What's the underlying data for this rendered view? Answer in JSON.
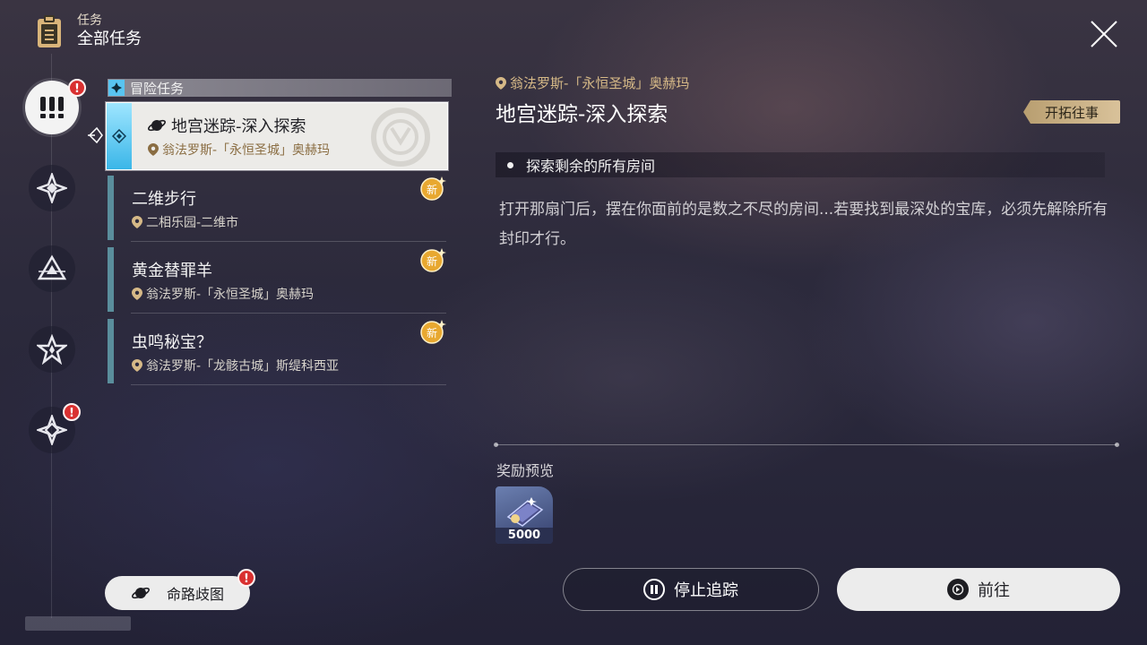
{
  "header": {
    "category_small": "任务",
    "category_main": "全部任务"
  },
  "nav": {
    "items": [
      {
        "name": "adventure",
        "active": true,
        "badge": "!"
      },
      {
        "name": "star-diamond",
        "active": false,
        "badge": ""
      },
      {
        "name": "triangle",
        "active": false,
        "badge": ""
      },
      {
        "name": "star",
        "active": false,
        "badge": ""
      },
      {
        "name": "diamond",
        "active": false,
        "badge": "!"
      }
    ]
  },
  "quest_list": {
    "category_label": "冒险任务",
    "quests": [
      {
        "title": "地宫迷踪-深入探索",
        "location": "翁法罗斯-「永恒圣城」奥赫玛",
        "selected": true,
        "new": false
      },
      {
        "title": "二维步行",
        "location": "二相乐园-二维市",
        "selected": false,
        "new": true
      },
      {
        "title": "黄金替罪羊",
        "location": "翁法罗斯-「永恒圣城」奥赫玛",
        "selected": false,
        "new": true
      },
      {
        "title": "虫鸣秘宝？",
        "location": "翁法罗斯-「龙骸古城」斯缇科西亚",
        "selected": false,
        "new": true
      }
    ],
    "new_label": "新"
  },
  "detail": {
    "location": "翁法罗斯-「永恒圣城」奥赫玛",
    "title": "地宫迷踪-深入探索",
    "trailblaze_button": "开拓往事",
    "objective": "探索剩余的所有房间",
    "description": "打开那扇门后，摆在你面前的是数之不尽的房间...若要找到最深处的宝库，必须先解除所有封印才行。"
  },
  "rewards": {
    "label": "奖励预览",
    "items": [
      {
        "icon": "credit-icon",
        "quantity": "5000"
      }
    ]
  },
  "buttons": {
    "stop_tracking": "停止追踪",
    "go": "前往"
  },
  "path_button": {
    "label": "命路歧图",
    "badge": "!"
  },
  "colors": {
    "accent_cyan": "#3ab6e8",
    "gold": "#d6b987",
    "badge_red": "#d93030"
  }
}
